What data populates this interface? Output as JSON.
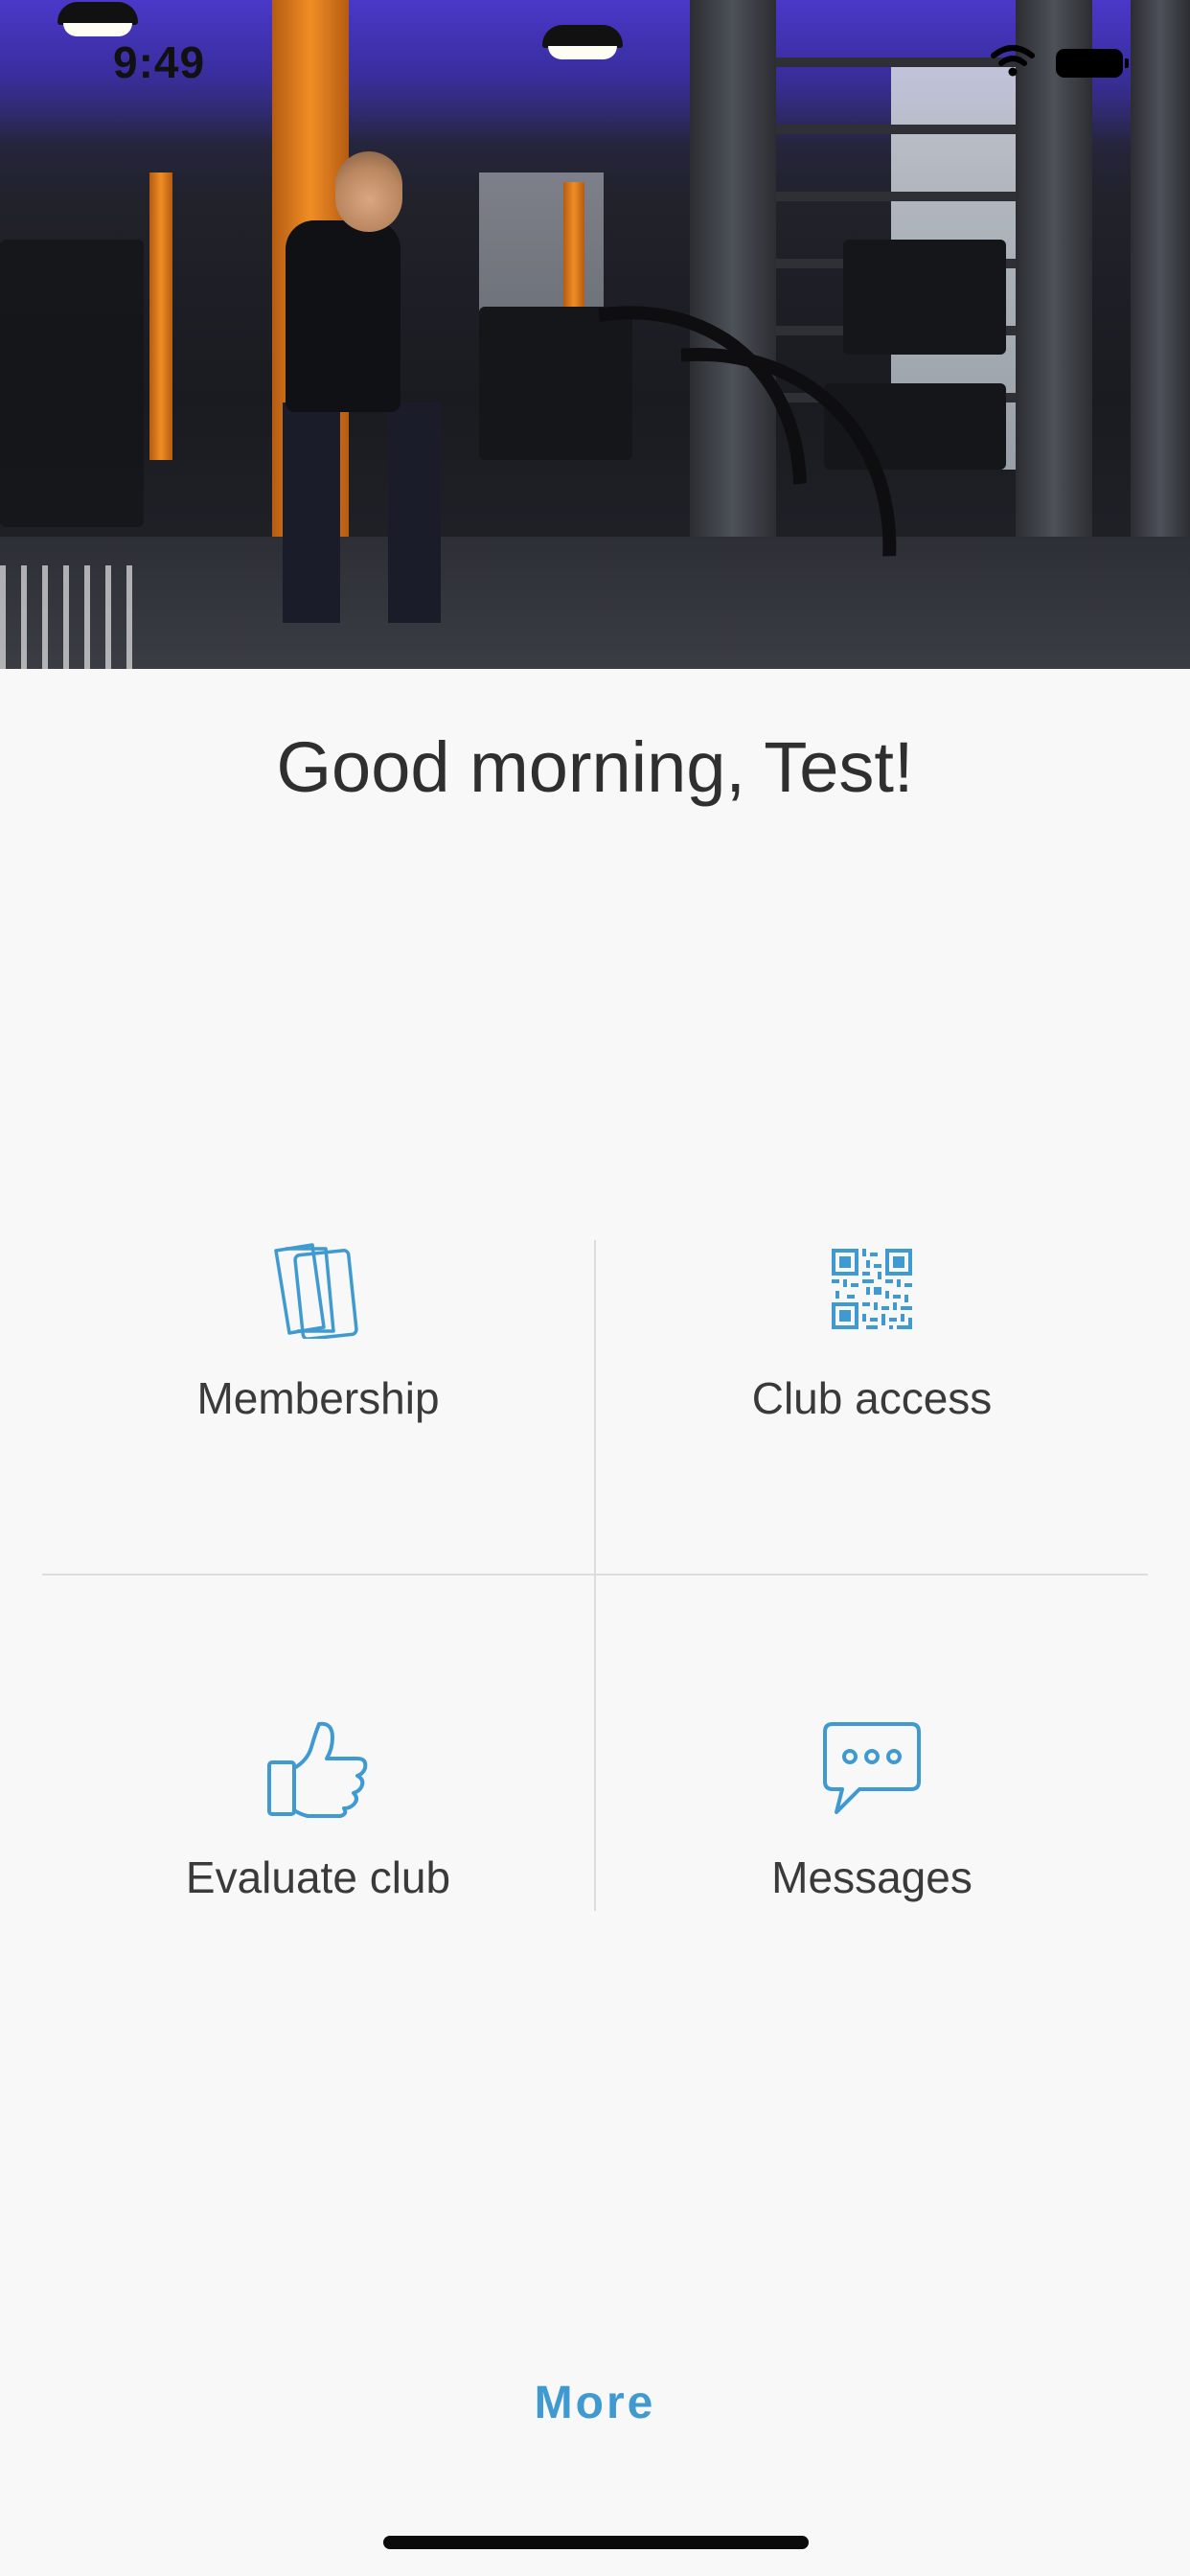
{
  "status": {
    "time": "9:49",
    "wifi_icon": "wifi-icon",
    "battery_icon": "battery-icon"
  },
  "hero": {
    "image": "gym-battle-rope-photo"
  },
  "greeting": "Good morning, Test!",
  "tiles": [
    {
      "label": "Membership",
      "icon": "membership-cards-icon"
    },
    {
      "label": "Club access",
      "icon": "qr-code-icon"
    },
    {
      "label": "Evaluate club",
      "icon": "thumbs-up-icon"
    },
    {
      "label": "Messages",
      "icon": "chat-bubble-icon"
    }
  ],
  "more_label": "More",
  "colors": {
    "accent": "#3f9ad1",
    "background": "#f8f8f8",
    "text": "#2f2f2f",
    "divider": "#dcdcdc"
  }
}
